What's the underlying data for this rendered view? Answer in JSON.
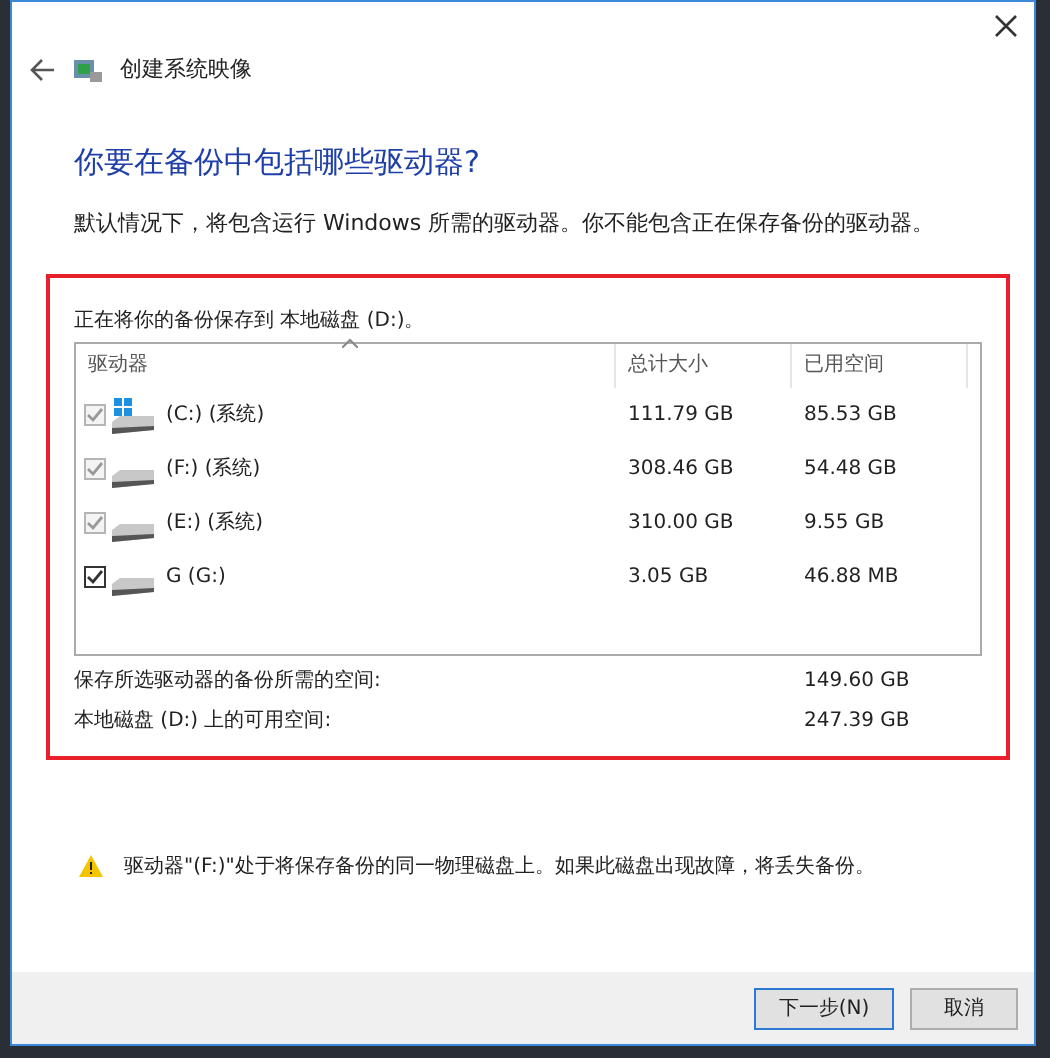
{
  "window": {
    "title": "创建系统映像"
  },
  "heading": "你要在备份中包括哪些驱动器?",
  "description": "默认情况下，将包含运行 Windows 所需的驱动器。你不能包含正在保存备份的驱动器。",
  "saving_to": "正在将你的备份保存到 本地磁盘 (D:)。",
  "table": {
    "columns": [
      "驱动器",
      "总计大小",
      "已用空间"
    ],
    "rows": [
      {
        "name": "(C:) (系统)",
        "size": "111.79 GB",
        "used": "85.53 GB",
        "checked": true,
        "disabled": true,
        "windows": true
      },
      {
        "name": "(F:) (系统)",
        "size": "308.46 GB",
        "used": "54.48 GB",
        "checked": true,
        "disabled": true,
        "windows": false
      },
      {
        "name": "(E:) (系统)",
        "size": "310.00 GB",
        "used": "9.55 GB",
        "checked": true,
        "disabled": true,
        "windows": false
      },
      {
        "name": "G (G:)",
        "size": "3.05 GB",
        "used": "46.88 MB",
        "checked": true,
        "disabled": false,
        "windows": false
      }
    ]
  },
  "summary": [
    {
      "label": "保存所选驱动器的备份所需的空间:",
      "value": "149.60 GB"
    },
    {
      "label": "本地磁盘 (D:) 上的可用空间:",
      "value": "247.39 GB"
    }
  ],
  "warning": "驱动器\"(F:)\"处于将保存备份的同一物理磁盘上。如果此磁盘出现故障，将丢失备份。",
  "buttons": [
    {
      "label": "下一步(N)",
      "default": true
    },
    {
      "label": "取消",
      "default": false
    }
  ]
}
